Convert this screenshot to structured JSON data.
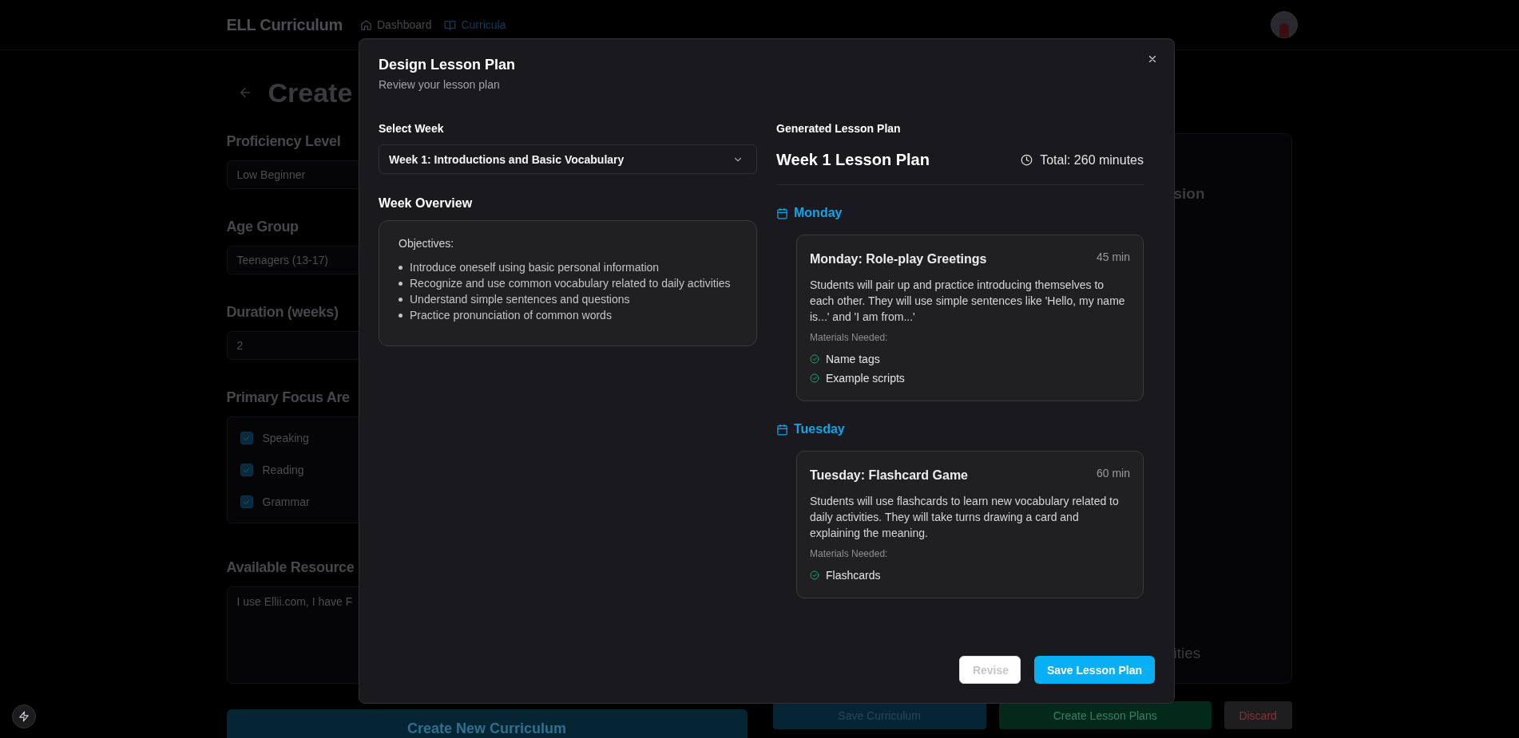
{
  "header": {
    "title": "ELL Curriculum",
    "nav": [
      {
        "label": "Dashboard",
        "selected": false
      },
      {
        "label": "Curricula",
        "selected": true
      }
    ]
  },
  "page": {
    "title": "Create",
    "form": [
      {
        "kind": "select",
        "label": "Proficiency Level",
        "value": "Low Beginner"
      },
      {
        "kind": "select",
        "label": "Age Group",
        "value": "Teenagers (13-17)"
      },
      {
        "kind": "input",
        "label": "Duration (weeks)",
        "value": "2"
      },
      {
        "kind": "checklist",
        "label": "Primary Focus Are",
        "options": [
          {
            "label": "Speaking",
            "checked": true
          },
          {
            "label": "Reading",
            "checked": true
          },
          {
            "label": "Grammar",
            "checked": true
          }
        ]
      },
      {
        "kind": "textarea",
        "label": "Available Resource",
        "value": "I use Ellii.com, I have F"
      }
    ],
    "create_button": "Create New Curriculum",
    "preview": {
      "texts": [
        "sion",
        "ities"
      ]
    },
    "actions": [
      {
        "label": "Save Curriculum",
        "kind": "primary"
      },
      {
        "label": "Create Lesson Plans",
        "kind": "success"
      },
      {
        "label": "Discard",
        "kind": "danger"
      }
    ]
  },
  "dialog": {
    "title": "Design Lesson Plan",
    "subtitle": "Review your lesson plan",
    "select_week": {
      "label": "Select Week",
      "value": "Week 1: Introductions and Basic Vocabulary"
    },
    "overview": {
      "heading": "Week Overview",
      "objectives_label": "Objectives:",
      "objectives": [
        "Introduce oneself using basic personal information",
        "Recognize and use common vocabulary related to daily activities",
        "Understand simple sentences and questions",
        "Practice pronunciation of common words"
      ]
    },
    "plan": {
      "heading": "Generated Lesson Plan",
      "title": "Week 1 Lesson Plan",
      "total": "Total: 260 minutes",
      "days": [
        {
          "day": "Monday",
          "activity": {
            "title": "Monday: Role-play Greetings",
            "duration": "45 min",
            "description": "Students will pair up and practice introducing themselves to each other. They will use simple sentences like 'Hello, my name is...' and 'I am from...'",
            "materials_label": "Materials Needed:",
            "materials": [
              "Name tags",
              "Example scripts"
            ]
          }
        },
        {
          "day": "Tuesday",
          "activity": {
            "title": "Tuesday: Flashcard Game",
            "duration": "60 min",
            "description": "Students will use flashcards to learn new vocabulary related to daily activities. They will take turns drawing a card and explaining the meaning.",
            "materials_label": "Materials Needed:",
            "materials": [
              "Flashcards"
            ]
          }
        }
      ]
    },
    "buttons": [
      {
        "label": "Revise",
        "kind": "outline"
      },
      {
        "label": "Save Lesson Plan",
        "kind": "primary"
      }
    ]
  }
}
